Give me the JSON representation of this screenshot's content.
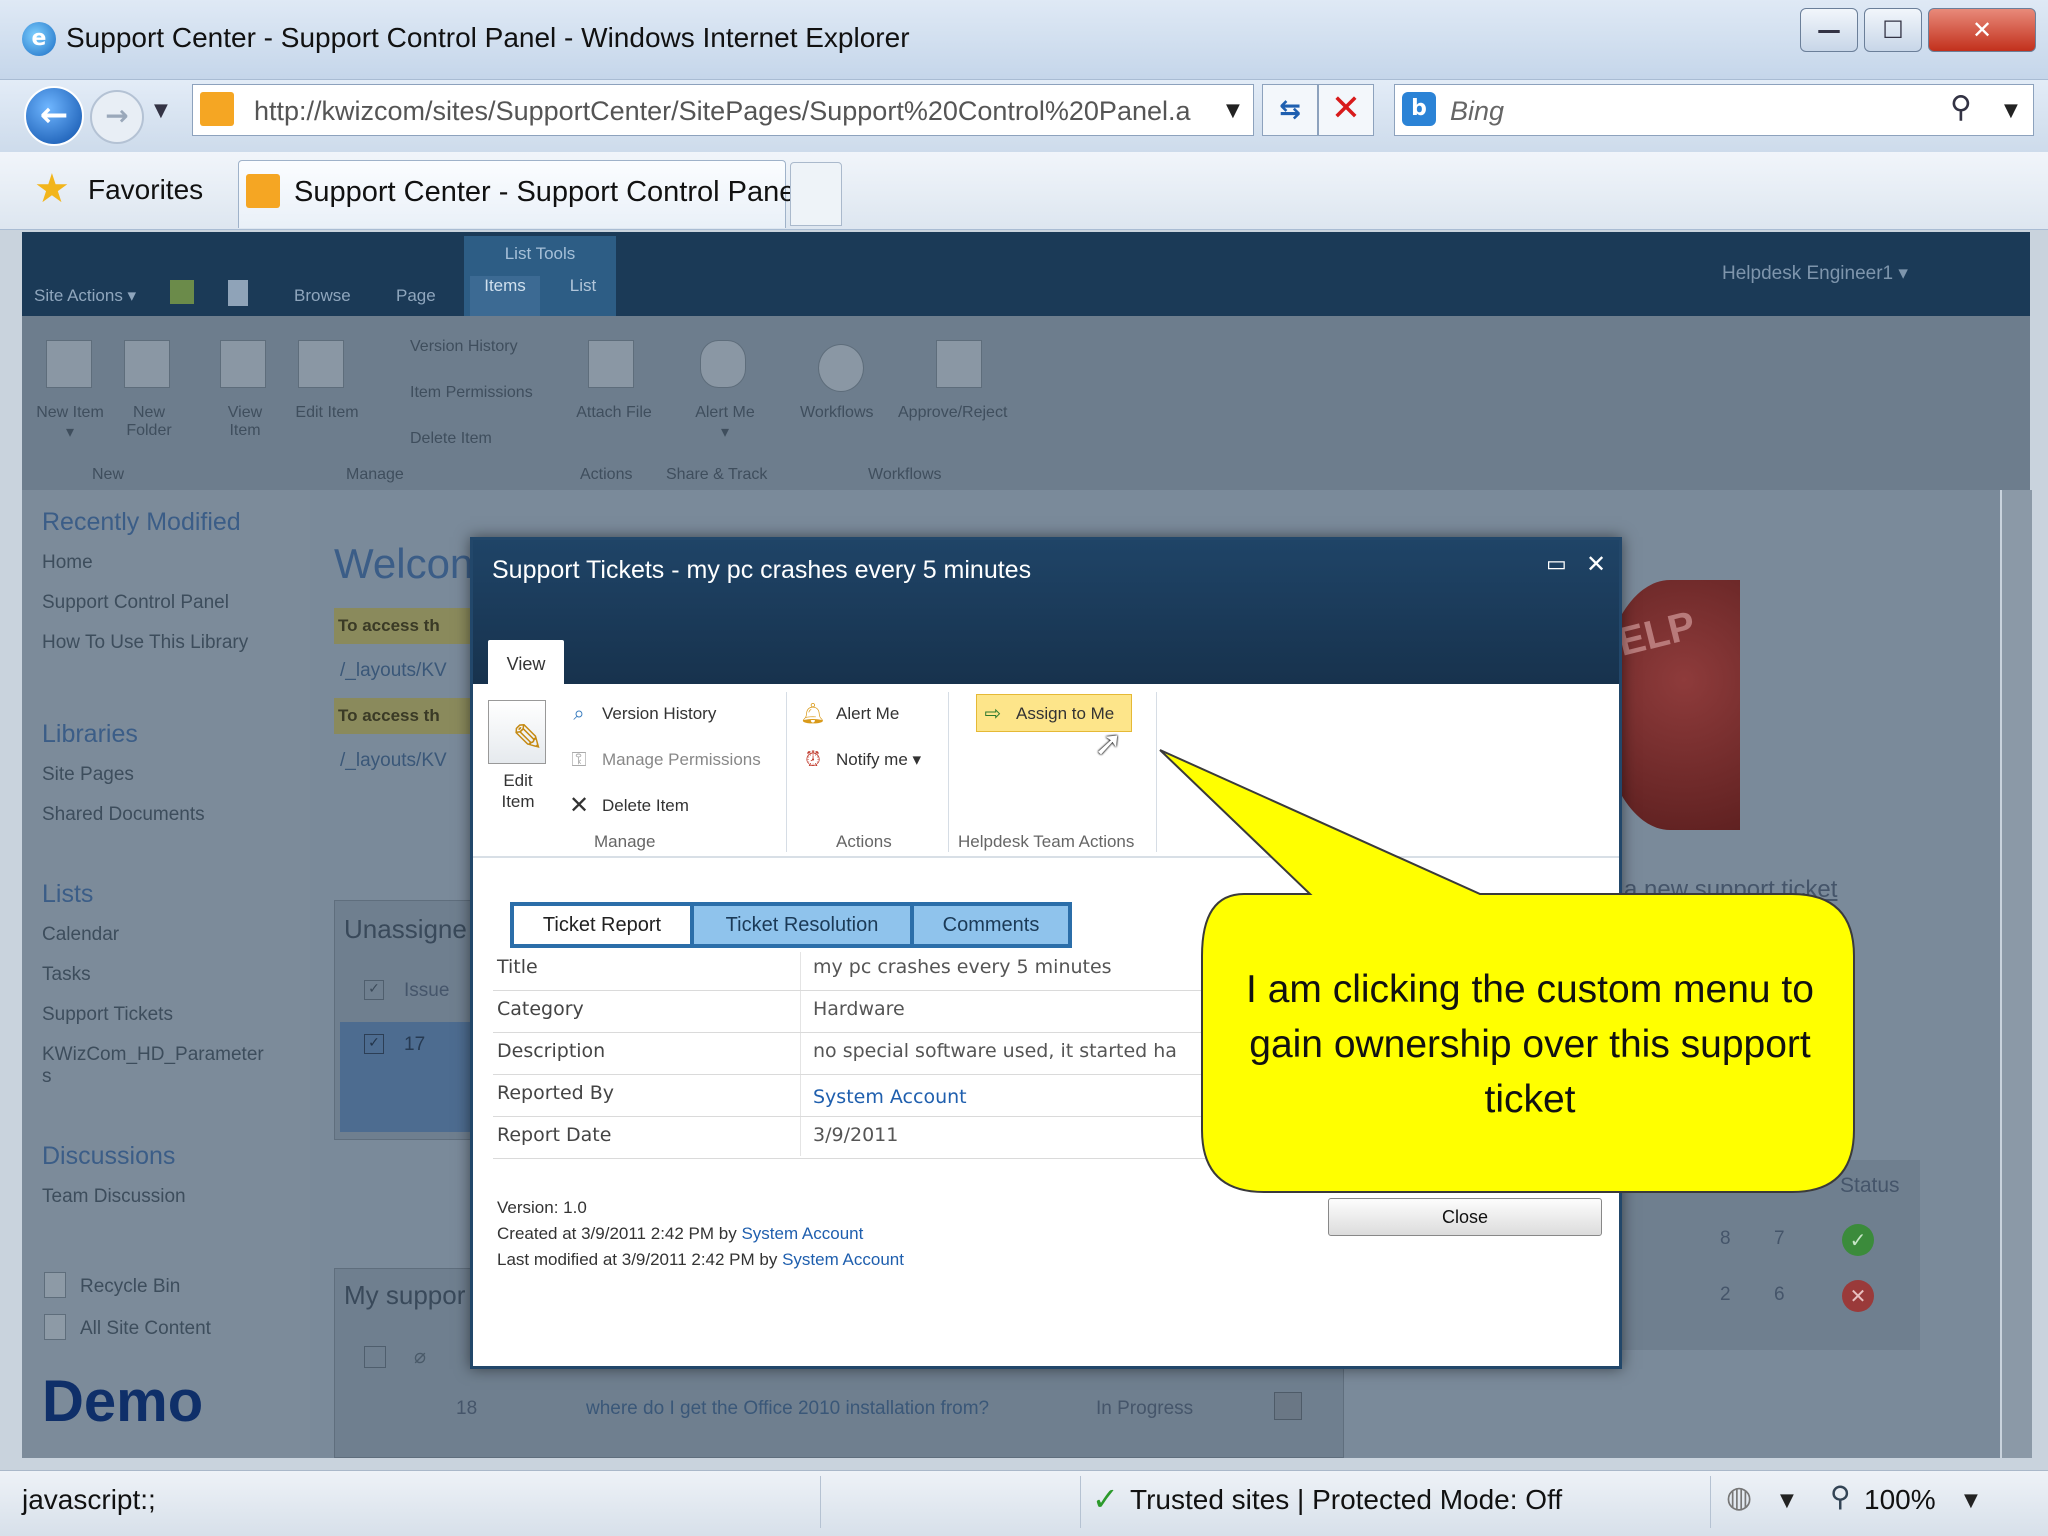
{
  "browser": {
    "window_title": "Support Center - Support Control Panel - Windows Internet Explorer",
    "url": "http://kwizcom/sites/SupportCenter/SitePages/Support%20Control%20Panel.a",
    "search_placeholder": "Bing",
    "favorites_label": "Favorites",
    "tab_label": "Support Center - Support Control Panel"
  },
  "sharepoint": {
    "tool_tab_group": "List Tools",
    "top_nav": [
      "Site Actions ▾",
      "Browse",
      "Page",
      "Items",
      "List"
    ],
    "user": "Helpdesk Engineer1 ▾",
    "ribbon_buttons": [
      "New Item ▾",
      "New Folder",
      "View Item",
      "Edit Item",
      "Version History",
      "Item Permissions",
      "Delete Item",
      "Attach File",
      "Alert Me ▾",
      "Workflows",
      "Approve/Reject"
    ],
    "ribbon_groups": [
      "New",
      "Manage",
      "Actions",
      "Share & Track",
      "Workflows"
    ],
    "left_nav": {
      "recently_modified": "Recently Modified",
      "recent_items": [
        "Home",
        "Support Control Panel",
        "How To Use This Library"
      ],
      "libraries": "Libraries",
      "library_items": [
        "Site Pages",
        "Shared Documents"
      ],
      "lists": "Lists",
      "list_items": [
        "Calendar",
        "Tasks",
        "Support Tickets",
        "KWizCom_HD_Parameter",
        "s"
      ],
      "discussions": "Discussions",
      "discussion_items": [
        "Team Discussion"
      ],
      "recycle_bin": "Recycle Bin",
      "all_site_content": "All Site Content"
    },
    "demo_label": "Demo",
    "welcome_partial": "Welcon",
    "note_partial_1": "To access th",
    "link_partial_1": "/_layouts/KV",
    "note_partial_2": "To access th",
    "link_partial_2": "/_layouts/KV",
    "webpart1_title": "Unassigne",
    "webpart1_col": "Issue",
    "webpart1_row": "17",
    "webpart2_title": "My suppor",
    "webpart2_row_id": "18",
    "webpart2_row_title": "where do I get the Office 2010 installation from?",
    "webpart2_row_status": "In Progress",
    "help_text": "ELP",
    "new_ticket_partial": "a new support ticket",
    "status_col": "Status",
    "status_rows": [
      [
        "8",
        "7"
      ],
      [
        "2",
        "6"
      ]
    ]
  },
  "dialog": {
    "title": "Support Tickets - my pc crashes every 5 minutes",
    "view_tab": "View",
    "ribbon": {
      "edit_item": "Edit Item",
      "version_history": "Version History",
      "manage_permissions": "Manage Permissions",
      "delete_item": "Delete Item",
      "group_manage": "Manage",
      "alert_me": "Alert Me",
      "notify_me": "Notify me ▾",
      "group_actions": "Actions",
      "assign_to_me": "Assign to Me",
      "group_helpdesk": "Helpdesk Team Actions"
    },
    "tabs": [
      "Ticket Report",
      "Ticket Resolution",
      "Comments"
    ],
    "fields": [
      {
        "label": "Title",
        "value": "my pc crashes every 5 minutes"
      },
      {
        "label": "Category",
        "value": "Hardware"
      },
      {
        "label": "Description",
        "value": "no special software used, it started ha"
      },
      {
        "label": "Reported By",
        "value": "System Account"
      },
      {
        "label": "Report Date",
        "value": "3/9/2011"
      }
    ],
    "meta": {
      "version": "Version: 1.0",
      "created_prefix": "Created at 3/9/2011 2:42 PM by",
      "created_by": "System Account",
      "modified_prefix": "Last modified at 3/9/2011 2:42 PM by",
      "modified_by": "System Account"
    },
    "close_label": "Close"
  },
  "callout": {
    "text": "I am clicking the custom menu to gain ownership over this support ticket",
    "color": "#ffff00"
  },
  "statusbar": {
    "left_text": "javascript:;",
    "zone": "Trusted sites | Protected Mode: Off",
    "zoom": "100%"
  }
}
